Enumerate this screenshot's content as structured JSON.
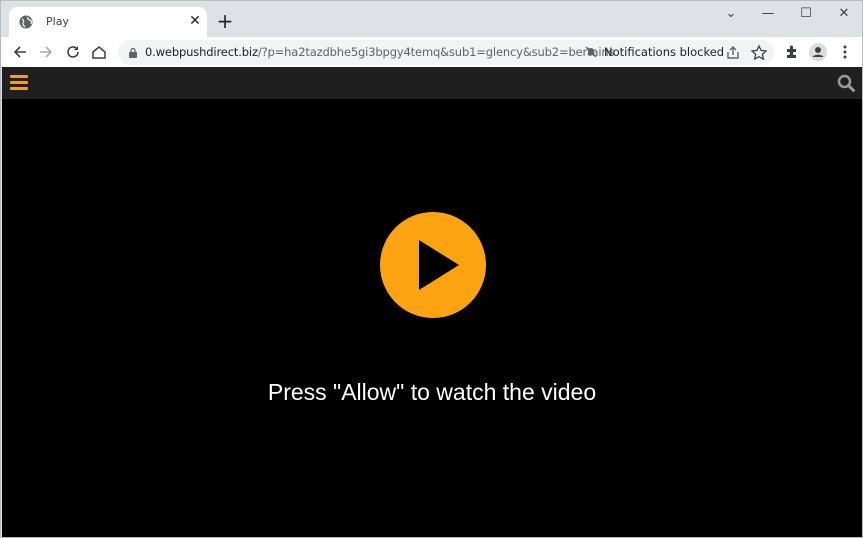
{
  "browser": {
    "tab": {
      "title": "Play",
      "favicon": "globe-icon",
      "close_icon": "close-icon"
    },
    "new_tab_icon": "plus-icon",
    "window_controls": {
      "tab_search": "chevron-down-icon",
      "minimize": "minimize-icon",
      "maximize": "maximize-icon",
      "close": "close-icon"
    },
    "nav": {
      "back": "arrow-left-icon",
      "forward": "arrow-right-icon",
      "reload": "reload-icon",
      "home": "home-icon"
    },
    "address_bar": {
      "lock_icon": "lock-icon",
      "url_host": "0.webpushdirect.biz",
      "url_rest": "/?p=ha2tazdbhe5gi3bpgy4temq&sub1=glency&sub2=bertains"
    },
    "notifications_status": "Notifications blocked",
    "toolbar_icons": [
      "share-icon",
      "star-icon",
      "extensions-icon",
      "profile-icon",
      "menu-icon"
    ]
  },
  "site": {
    "header": {
      "menu_icon": "hamburger-icon",
      "search_icon": "search-icon"
    },
    "accent_color": "#f6a01a",
    "caption": "Press \"Allow\" to watch the video"
  }
}
